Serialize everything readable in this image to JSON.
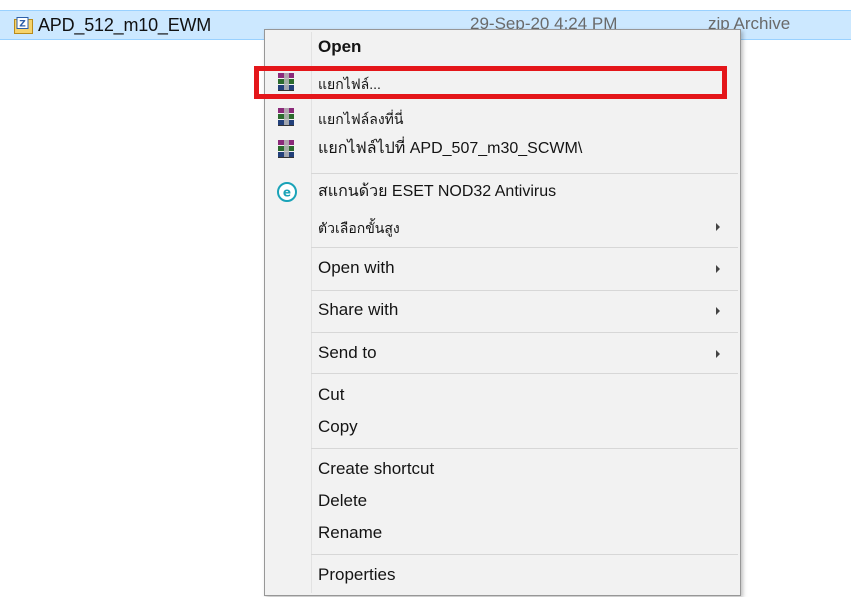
{
  "file": {
    "name": "APD_512_m10_EWM",
    "date": "29-Sep-20 4:24 PM",
    "type": "zip Archive",
    "icon": "winzip-archive-icon"
  },
  "menu": {
    "open": "Open",
    "extract_files": "แยกไฟล์...",
    "extract_here": "แยกไฟล์ลงที่นี่",
    "extract_to": "แยกไฟล์ไปที่ APD_507_m30_SCWM\\",
    "scan_eset": "สแกนด้วย ESET NOD32 Antivirus",
    "advanced_options": "ตัวเลือกขั้นสูง",
    "open_with": "Open with",
    "share_with": "Share with",
    "send_to": "Send to",
    "cut": "Cut",
    "copy": "Copy",
    "create_shortcut": "Create shortcut",
    "delete": "Delete",
    "rename": "Rename",
    "properties": "Properties"
  },
  "colors": {
    "highlight": "#e4161a",
    "selection": "#cce8ff",
    "menu_bg": "#f2f2f2",
    "eset_icon": "#1aa3b8"
  }
}
